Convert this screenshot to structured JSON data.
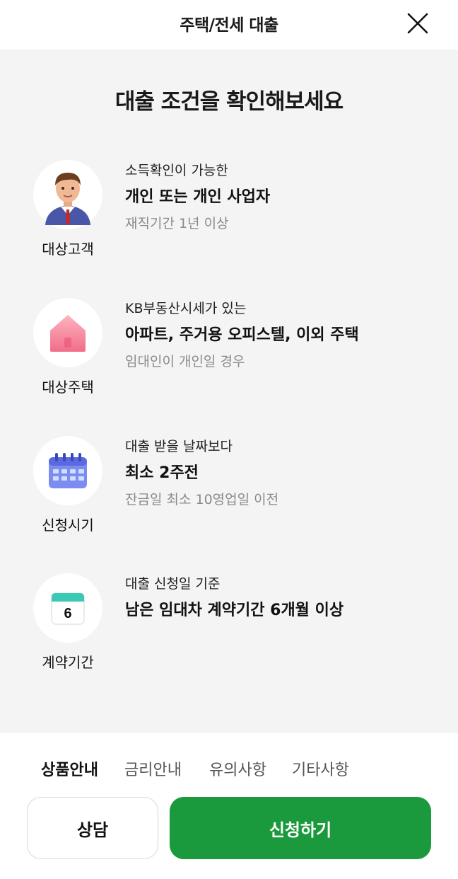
{
  "header": {
    "title": "주택/전세 대출"
  },
  "main": {
    "title": "대출 조건을 확인해보세요",
    "conditions": [
      {
        "icon": "businessman-icon",
        "label": "대상고객",
        "sub": "소득확인이 가능한",
        "main": "개인 또는 개인 사업자",
        "note": "재직기간 1년 이상"
      },
      {
        "icon": "house-icon",
        "label": "대상주택",
        "sub": "KB부동산시세가 있는",
        "main": "아파트, 주거용 오피스텔, 이외 주택",
        "note": "임대인이 개인일 경우"
      },
      {
        "icon": "calendar-icon",
        "label": "신청시기",
        "sub": "대출 받을 날짜보다",
        "main": "최소 2주전",
        "note": "잔금일 최소 10영업일 이전"
      },
      {
        "icon": "calendar-day-icon",
        "label": "계약기간",
        "sub": "대출 신청일 기준",
        "main": "남은 임대차 계약기간 6개월 이상",
        "note": "",
        "day": "6"
      }
    ]
  },
  "tabs": [
    "상품안내",
    "금리안내",
    "유의사항",
    "기타사항"
  ],
  "buttons": {
    "consult": "상담",
    "apply": "신청하기"
  },
  "colors": {
    "accent": "#1a9a3c",
    "background": "#f4f4f4"
  }
}
